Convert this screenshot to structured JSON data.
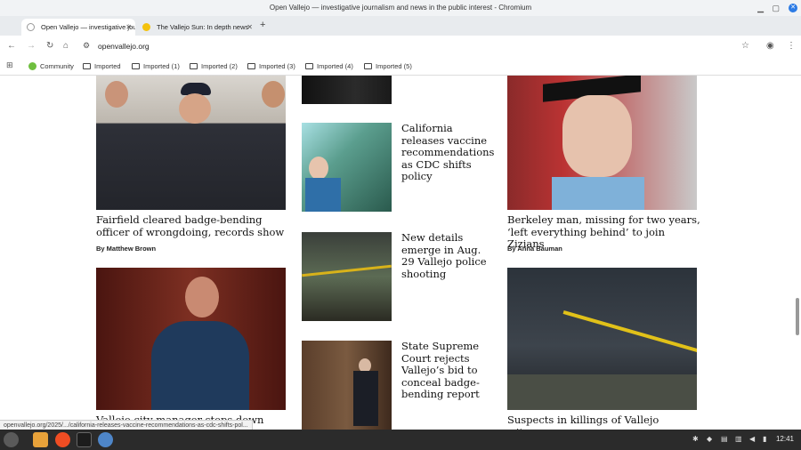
{
  "window": {
    "title": "Open Vallejo — investigative journalism and news in the public interest - Chromium"
  },
  "tabs": [
    {
      "label": "Open Vallejo — investigative journalism",
      "active": true
    },
    {
      "label": "The Vallejo Sun: In depth news",
      "active": false
    }
  ],
  "address_bar": {
    "url": "openvallejo.org"
  },
  "bookmarks": [
    "Community",
    "Imported",
    "Imported (1)",
    "Imported (2)",
    "Imported (3)",
    "Imported (4)",
    "Imported (5)"
  ],
  "articles": {
    "left1": {
      "headline": "Fairfield cleared badge-bending officer of wrongdoing, records show",
      "byline": "By Matthew Brown"
    },
    "left2": {
      "headline": "Vallejo city manager steps down after less"
    },
    "mid1": {
      "headline": "California releases vaccine recommendations as CDC shifts policy"
    },
    "mid2": {
      "headline": "New details emerge in Aug. 29 Vallejo police shooting"
    },
    "mid3": {
      "headline": "State Supreme Court rejects Vallejo’s bid to conceal badge-bending report"
    },
    "right1": {
      "headline": "Berkeley man, missing for two years, ‘left everything behind’ to join Zizians",
      "byline": "By Anna Bauman"
    },
    "right2": {
      "headline": "Suspects in killings of Vallejo witness,"
    }
  },
  "status_url": "openvallejo.org/2025/.../california-releases-vaccine-recommendations-as-cdc-shifts-pol...",
  "taskbar": {
    "clock": "12:41"
  }
}
